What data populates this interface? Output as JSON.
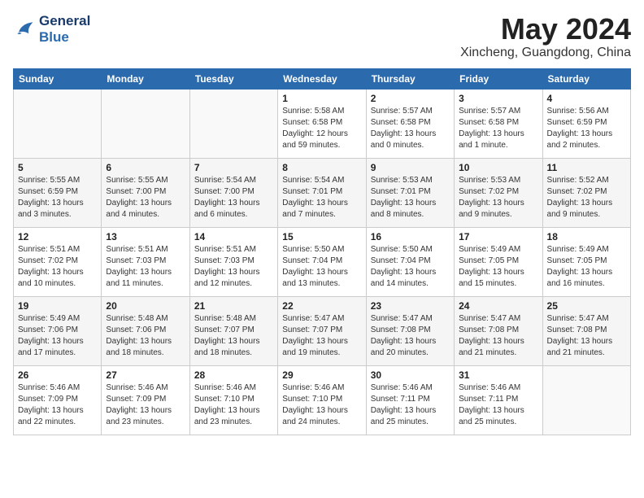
{
  "header": {
    "logo_line1": "General",
    "logo_line2": "Blue",
    "month_year": "May 2024",
    "location": "Xincheng, Guangdong, China"
  },
  "weekdays": [
    "Sunday",
    "Monday",
    "Tuesday",
    "Wednesday",
    "Thursday",
    "Friday",
    "Saturday"
  ],
  "weeks": [
    [
      {
        "day": "",
        "sunrise": "",
        "sunset": "",
        "daylight": ""
      },
      {
        "day": "",
        "sunrise": "",
        "sunset": "",
        "daylight": ""
      },
      {
        "day": "",
        "sunrise": "",
        "sunset": "",
        "daylight": ""
      },
      {
        "day": "1",
        "sunrise": "Sunrise: 5:58 AM",
        "sunset": "Sunset: 6:58 PM",
        "daylight": "Daylight: 12 hours and 59 minutes."
      },
      {
        "day": "2",
        "sunrise": "Sunrise: 5:57 AM",
        "sunset": "Sunset: 6:58 PM",
        "daylight": "Daylight: 13 hours and 0 minutes."
      },
      {
        "day": "3",
        "sunrise": "Sunrise: 5:57 AM",
        "sunset": "Sunset: 6:58 PM",
        "daylight": "Daylight: 13 hours and 1 minute."
      },
      {
        "day": "4",
        "sunrise": "Sunrise: 5:56 AM",
        "sunset": "Sunset: 6:59 PM",
        "daylight": "Daylight: 13 hours and 2 minutes."
      }
    ],
    [
      {
        "day": "5",
        "sunrise": "Sunrise: 5:55 AM",
        "sunset": "Sunset: 6:59 PM",
        "daylight": "Daylight: 13 hours and 3 minutes."
      },
      {
        "day": "6",
        "sunrise": "Sunrise: 5:55 AM",
        "sunset": "Sunset: 7:00 PM",
        "daylight": "Daylight: 13 hours and 4 minutes."
      },
      {
        "day": "7",
        "sunrise": "Sunrise: 5:54 AM",
        "sunset": "Sunset: 7:00 PM",
        "daylight": "Daylight: 13 hours and 6 minutes."
      },
      {
        "day": "8",
        "sunrise": "Sunrise: 5:54 AM",
        "sunset": "Sunset: 7:01 PM",
        "daylight": "Daylight: 13 hours and 7 minutes."
      },
      {
        "day": "9",
        "sunrise": "Sunrise: 5:53 AM",
        "sunset": "Sunset: 7:01 PM",
        "daylight": "Daylight: 13 hours and 8 minutes."
      },
      {
        "day": "10",
        "sunrise": "Sunrise: 5:53 AM",
        "sunset": "Sunset: 7:02 PM",
        "daylight": "Daylight: 13 hours and 9 minutes."
      },
      {
        "day": "11",
        "sunrise": "Sunrise: 5:52 AM",
        "sunset": "Sunset: 7:02 PM",
        "daylight": "Daylight: 13 hours and 9 minutes."
      }
    ],
    [
      {
        "day": "12",
        "sunrise": "Sunrise: 5:51 AM",
        "sunset": "Sunset: 7:02 PM",
        "daylight": "Daylight: 13 hours and 10 minutes."
      },
      {
        "day": "13",
        "sunrise": "Sunrise: 5:51 AM",
        "sunset": "Sunset: 7:03 PM",
        "daylight": "Daylight: 13 hours and 11 minutes."
      },
      {
        "day": "14",
        "sunrise": "Sunrise: 5:51 AM",
        "sunset": "Sunset: 7:03 PM",
        "daylight": "Daylight: 13 hours and 12 minutes."
      },
      {
        "day": "15",
        "sunrise": "Sunrise: 5:50 AM",
        "sunset": "Sunset: 7:04 PM",
        "daylight": "Daylight: 13 hours and 13 minutes."
      },
      {
        "day": "16",
        "sunrise": "Sunrise: 5:50 AM",
        "sunset": "Sunset: 7:04 PM",
        "daylight": "Daylight: 13 hours and 14 minutes."
      },
      {
        "day": "17",
        "sunrise": "Sunrise: 5:49 AM",
        "sunset": "Sunset: 7:05 PM",
        "daylight": "Daylight: 13 hours and 15 minutes."
      },
      {
        "day": "18",
        "sunrise": "Sunrise: 5:49 AM",
        "sunset": "Sunset: 7:05 PM",
        "daylight": "Daylight: 13 hours and 16 minutes."
      }
    ],
    [
      {
        "day": "19",
        "sunrise": "Sunrise: 5:49 AM",
        "sunset": "Sunset: 7:06 PM",
        "daylight": "Daylight: 13 hours and 17 minutes."
      },
      {
        "day": "20",
        "sunrise": "Sunrise: 5:48 AM",
        "sunset": "Sunset: 7:06 PM",
        "daylight": "Daylight: 13 hours and 18 minutes."
      },
      {
        "day": "21",
        "sunrise": "Sunrise: 5:48 AM",
        "sunset": "Sunset: 7:07 PM",
        "daylight": "Daylight: 13 hours and 18 minutes."
      },
      {
        "day": "22",
        "sunrise": "Sunrise: 5:47 AM",
        "sunset": "Sunset: 7:07 PM",
        "daylight": "Daylight: 13 hours and 19 minutes."
      },
      {
        "day": "23",
        "sunrise": "Sunrise: 5:47 AM",
        "sunset": "Sunset: 7:08 PM",
        "daylight": "Daylight: 13 hours and 20 minutes."
      },
      {
        "day": "24",
        "sunrise": "Sunrise: 5:47 AM",
        "sunset": "Sunset: 7:08 PM",
        "daylight": "Daylight: 13 hours and 21 minutes."
      },
      {
        "day": "25",
        "sunrise": "Sunrise: 5:47 AM",
        "sunset": "Sunset: 7:08 PM",
        "daylight": "Daylight: 13 hours and 21 minutes."
      }
    ],
    [
      {
        "day": "26",
        "sunrise": "Sunrise: 5:46 AM",
        "sunset": "Sunset: 7:09 PM",
        "daylight": "Daylight: 13 hours and 22 minutes."
      },
      {
        "day": "27",
        "sunrise": "Sunrise: 5:46 AM",
        "sunset": "Sunset: 7:09 PM",
        "daylight": "Daylight: 13 hours and 23 minutes."
      },
      {
        "day": "28",
        "sunrise": "Sunrise: 5:46 AM",
        "sunset": "Sunset: 7:10 PM",
        "daylight": "Daylight: 13 hours and 23 minutes."
      },
      {
        "day": "29",
        "sunrise": "Sunrise: 5:46 AM",
        "sunset": "Sunset: 7:10 PM",
        "daylight": "Daylight: 13 hours and 24 minutes."
      },
      {
        "day": "30",
        "sunrise": "Sunrise: 5:46 AM",
        "sunset": "Sunset: 7:11 PM",
        "daylight": "Daylight: 13 hours and 25 minutes."
      },
      {
        "day": "31",
        "sunrise": "Sunrise: 5:46 AM",
        "sunset": "Sunset: 7:11 PM",
        "daylight": "Daylight: 13 hours and 25 minutes."
      },
      {
        "day": "",
        "sunrise": "",
        "sunset": "",
        "daylight": ""
      }
    ]
  ]
}
